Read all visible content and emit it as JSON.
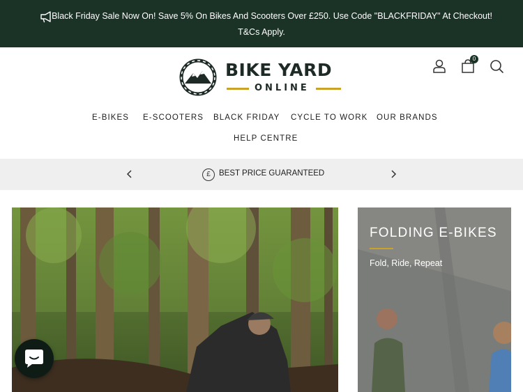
{
  "announcement": {
    "line1": "Black Friday Sale Now On! Save 5% On Bikes And Scooters Over £250. Use Code \"BLACKFRIDAY\" At Checkout!",
    "line2": "T&Cs Apply.",
    "icon": "megaphone-icon"
  },
  "brand": {
    "name": "BIKE YARD",
    "sub": "ONLINE",
    "accent": "#c9a227",
    "dark": "#1b3227"
  },
  "header": {
    "cart_count": "0",
    "icons": [
      "account-icon",
      "cart-icon",
      "search-icon"
    ]
  },
  "nav": [
    {
      "label": "E-BIKES"
    },
    {
      "label": "E-SCOOTERS"
    },
    {
      "label": "BLACK FRIDAY"
    },
    {
      "label": "CYCLE TO WORK"
    },
    {
      "label": "OUR BRANDS"
    },
    {
      "label": "HELP CENTRE"
    }
  ],
  "promo": {
    "text": "BEST PRICE GUARANTEED",
    "symbol": "£"
  },
  "tile": {
    "title": "FOLDING E-BIKES",
    "subtitle": "Fold, Ride, Repeat"
  }
}
